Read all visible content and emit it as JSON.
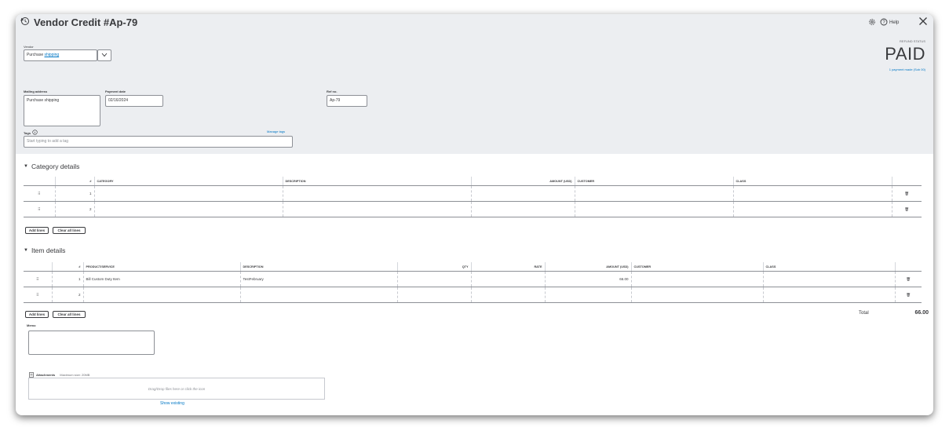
{
  "title": "Vendor Credit #Ap-79",
  "header_right": {
    "help_label": "Help"
  },
  "vendor": {
    "label": "Vendor",
    "value_prefix": "Purchase ",
    "value_link": "shipping"
  },
  "refund": {
    "status_label": "REFUND STATUS",
    "status": "PAID",
    "payment_link": "1 payment made (Sob 00)"
  },
  "mailing": {
    "label": "Mailing address",
    "value": "Purchase shipping"
  },
  "payment_date": {
    "label": "Payment date",
    "value": "02/16/2024"
  },
  "ref": {
    "label": "Ref no.",
    "value": "Ap-79"
  },
  "tags": {
    "label": "Tags",
    "manage": "Manage tags",
    "placeholder": "Start typing to add a tag"
  },
  "category": {
    "title": "Category details",
    "columns": [
      "#",
      "CATEGORY",
      "DESCRIPTION",
      "AMOUNT (USD)",
      "CUSTOMER",
      "CLASS"
    ],
    "rows": [
      {
        "num": "1",
        "category": "",
        "description": "",
        "amount": "",
        "customer": "",
        "class": ""
      },
      {
        "num": "2",
        "category": "",
        "description": "",
        "amount": "",
        "customer": "",
        "class": ""
      }
    ],
    "add_lines": "Add lines",
    "clear_lines": "Clear all lines"
  },
  "items": {
    "title": "Item details",
    "columns": [
      "#",
      "PRODUCT/SERVICE",
      "DESCRIPTION",
      "QTY",
      "RATE",
      "AMOUNT (USD)",
      "CUSTOMER",
      "CLASS"
    ],
    "rows": [
      {
        "num": "1",
        "product": "Bill Custom Duty Item",
        "description": "TestFebruary",
        "qty": "",
        "rate": "",
        "amount": "66.00",
        "customer": "",
        "class": ""
      },
      {
        "num": "2",
        "product": "",
        "description": "",
        "qty": "",
        "rate": "",
        "amount": "",
        "customer": "",
        "class": ""
      }
    ],
    "add_lines": "Add lines",
    "clear_lines": "Clear all lines"
  },
  "total": {
    "label": "Total",
    "value": "66.00"
  },
  "memo": {
    "label": "Memo"
  },
  "attachments": {
    "label": "Attachments",
    "max_size": "Maximum size: 20MB",
    "drop_text": "Drag/Drop files here or click the icon",
    "show_existing": "Show existing"
  },
  "icons": {
    "title_icon": "vendor-credit-icon",
    "settings": "gear-icon",
    "help": "help-circle-icon",
    "close": "close-icon",
    "dropdown": "chevron-down-icon",
    "info": "info-icon",
    "drag": "drag-handle-icon",
    "trash": "trash-icon",
    "attachment": "paperclip-icon"
  },
  "colors": {
    "header_bg": "#eceef1",
    "link": "#0077c5",
    "text": "#393a3d"
  }
}
